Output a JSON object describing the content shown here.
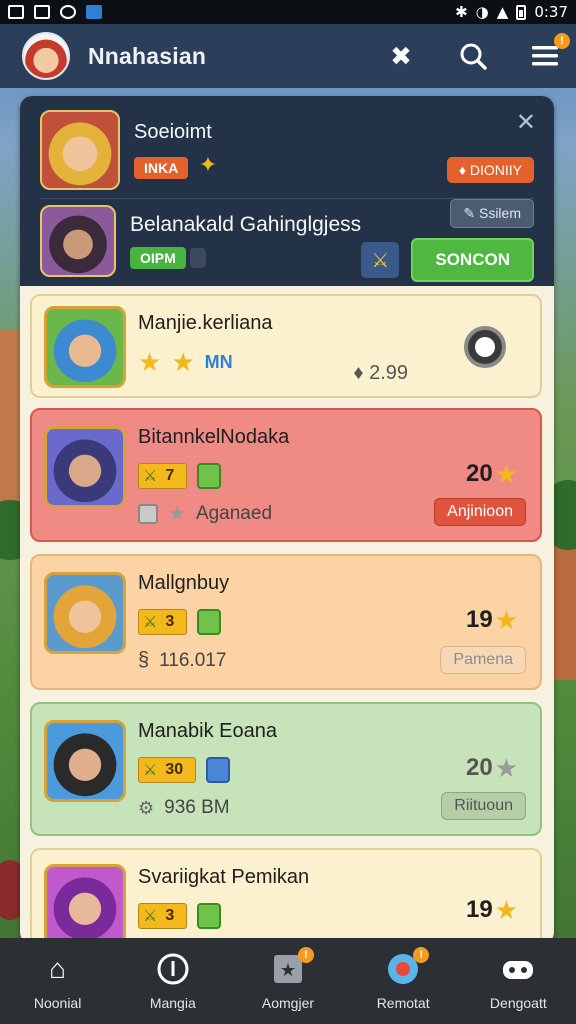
{
  "status_bar": {
    "time": "0:37"
  },
  "app_bar": {
    "title": "Nnahasian",
    "menu_badge": "!"
  },
  "header": {
    "player1": {
      "name": "Soeioimt",
      "tag": "INKA",
      "badge": "♦ DIONIIY"
    },
    "player2": {
      "name": "Belanakald Gahinglgjess",
      "status": "OIPM",
      "badge": "✎ Ssilem",
      "action_label": "SONCON"
    }
  },
  "cards": [
    {
      "name": "Manjie.kerliana",
      "tag": "MN",
      "price": "♦ 2.99",
      "bg": "#fbf1cf"
    },
    {
      "name": "BitannkelNodaka",
      "level": "7",
      "status": "Aganaed",
      "score": "20",
      "action": "Anjinioon",
      "bg": "#f08a85"
    },
    {
      "name": "Mallgnbuy",
      "level": "3",
      "value": "116.017",
      "score": "19",
      "action": "Pamena",
      "bg": "#fbd3a4"
    },
    {
      "name": "Manabik Eoana",
      "level": "30",
      "value": "936 BM",
      "score": "20",
      "action": "Riituoun",
      "bg": "#c6e3b9"
    },
    {
      "name": "Svariigkat Pemikan",
      "level": "3",
      "score": "19",
      "bg": "#fbf1cf"
    }
  ],
  "bottom_nav": [
    {
      "label": "Noonial",
      "icon": "home-icon"
    },
    {
      "label": "Mangia",
      "icon": "info-circle-icon"
    },
    {
      "label": "Aomgjer",
      "icon": "star-box-icon",
      "badge": "!"
    },
    {
      "label": "Remotat",
      "icon": "record-icon",
      "badge": "!"
    },
    {
      "label": "Dengoatt",
      "icon": "controller-icon"
    }
  ]
}
